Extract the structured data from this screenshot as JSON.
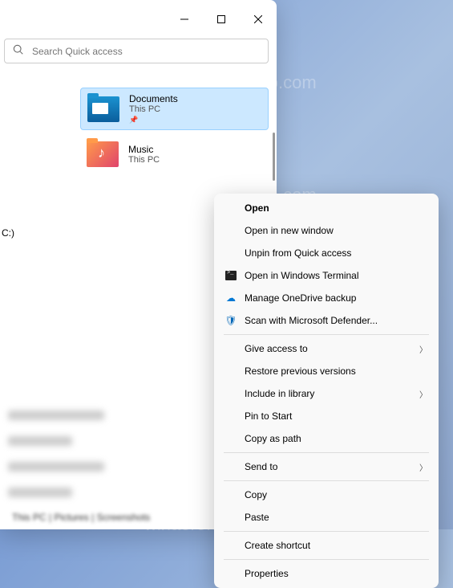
{
  "watermark": "winaero.com",
  "search": {
    "placeholder": "Search Quick access"
  },
  "items": [
    {
      "name": "Documents",
      "location": "This PC",
      "pinned": true
    },
    {
      "name": "Music",
      "location": "This PC",
      "pinned": false
    }
  ],
  "drive_label": "C:)",
  "context_menu": {
    "open": "Open",
    "open_new_window": "Open in new window",
    "unpin": "Unpin from Quick access",
    "terminal": "Open in Windows Terminal",
    "onedrive": "Manage OneDrive backup",
    "defender": "Scan with Microsoft Defender...",
    "give_access": "Give access to",
    "restore": "Restore previous versions",
    "include_library": "Include in library",
    "pin_start": "Pin to Start",
    "copy_path": "Copy as path",
    "send_to": "Send to",
    "copy": "Copy",
    "paste": "Paste",
    "create_shortcut": "Create shortcut",
    "properties": "Properties"
  },
  "bottom_text": "This PC | Pictures | Screenshots"
}
